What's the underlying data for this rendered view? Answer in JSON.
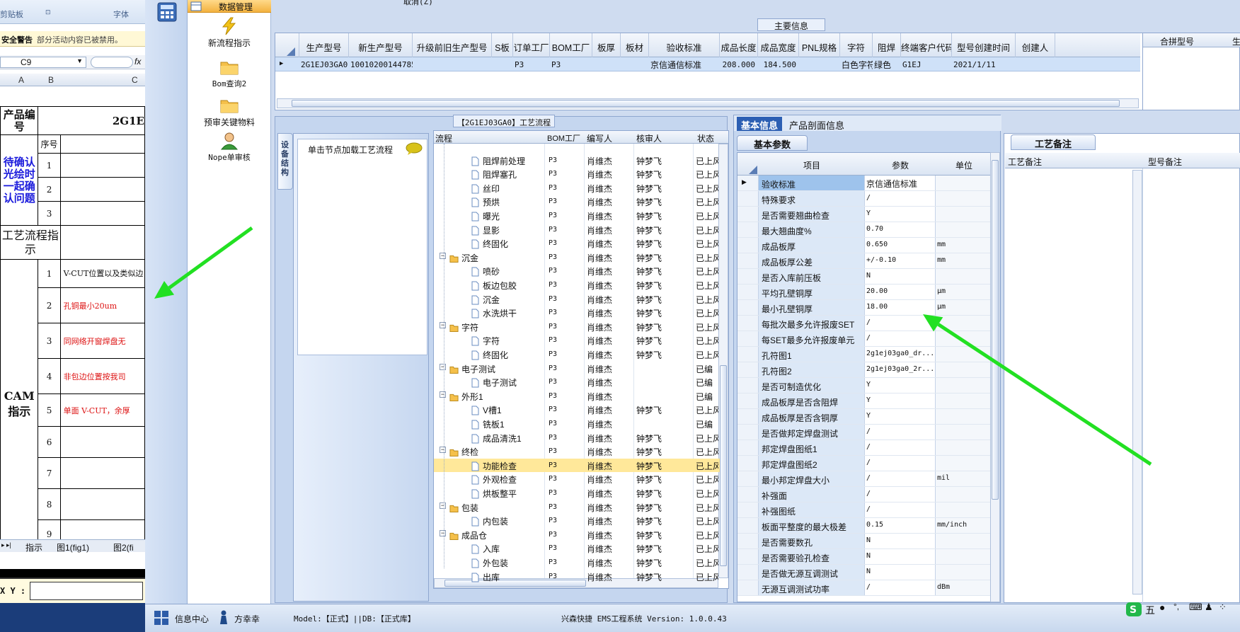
{
  "excel": {
    "ribbon_left": "剪贴板",
    "ribbon_right": "字体",
    "warning_title": "安全警告",
    "warning_text": "部分活动内容已被禁用。",
    "namebox": "C9",
    "fx": "fx",
    "columns": [
      "A",
      "B",
      "C"
    ],
    "product_label": "产品编号",
    "product_value": "2G1E",
    "confirm_label": "待确认光绘时一起确认问题",
    "seq_header": "序号",
    "process_label": "工艺流程指示",
    "cam_label": "CAM指示",
    "rows": [
      {
        "n": "1",
        "text": ""
      },
      {
        "n": "2",
        "text": ""
      },
      {
        "n": "3",
        "text": ""
      }
    ],
    "cam_rows": [
      {
        "n": "1",
        "text": "V-CUT位置以及类似边"
      },
      {
        "n": "2",
        "text": "孔铜最小20um"
      },
      {
        "n": "3",
        "text": "同网络开窗焊盘无"
      },
      {
        "n": "4",
        "text": "非包边位置按我司"
      },
      {
        "n": "5",
        "text": "单面 V-CUT，余厚"
      },
      {
        "n": "6",
        "text": ""
      },
      {
        "n": "7",
        "text": ""
      },
      {
        "n": "8",
        "text": ""
      },
      {
        "n": "9",
        "text": ""
      }
    ],
    "sheet_tabs": [
      "指示",
      "图1(fig1)",
      "图2(fi"
    ],
    "xy_label": "X Y :"
  },
  "nav": {
    "header": "数据管理",
    "items": [
      {
        "label": "新流程指示",
        "icon": "lightning-icon"
      },
      {
        "label": "Bom查询2",
        "icon": "folder-icon"
      },
      {
        "label": "预审关键物料",
        "icon": "folder-icon"
      },
      {
        "label": "Nope单审核",
        "icon": "user-icon"
      }
    ]
  },
  "top": {
    "cancel_label": "取消(Z)",
    "main_info_title": "主要信息",
    "columns": [
      "生产型号",
      "新生产型号",
      "升级前旧生产型号",
      "S板",
      "订单工厂",
      "BOM工厂",
      "板厚",
      "板材",
      "验收标准",
      "成品长度",
      "成品宽度",
      "PNL规格",
      "字符",
      "阻焊",
      "终端客户代码",
      "型号创建时间",
      "创建人"
    ],
    "row": [
      "2G1EJ03GA0",
      "10010200144785",
      "",
      "",
      "P3",
      "P3",
      "",
      "",
      "京信通信标准",
      "208.000",
      "184.500",
      "",
      "白色字符",
      "绿色",
      "G1EJ",
      "2021/1/11",
      ""
    ],
    "merge_header": "合拼型号",
    "merge_header2": "生"
  },
  "process": {
    "title": "【2G1EJ03GA0】工艺流程",
    "structure_tab": "设备结构",
    "load_hint": "单击节点加载工艺流程",
    "headers": [
      "流程",
      "BOM工厂",
      "编写人",
      "核审人",
      "状态"
    ],
    "rows": [
      {
        "level": 2,
        "name": "",
        "factory": "",
        "writer": "",
        "reviewer": "",
        "status": "",
        "group": false
      },
      {
        "level": 2,
        "name": "阻焊前处理",
        "factory": "P3",
        "writer": "肖维杰",
        "reviewer": "钟梦飞",
        "status": "已上风",
        "group": false
      },
      {
        "level": 2,
        "name": "阻焊塞孔",
        "factory": "P3",
        "writer": "肖维杰",
        "reviewer": "钟梦飞",
        "status": "已上风",
        "group": false
      },
      {
        "level": 2,
        "name": "丝印",
        "factory": "P3",
        "writer": "肖维杰",
        "reviewer": "钟梦飞",
        "status": "已上风",
        "group": false
      },
      {
        "level": 2,
        "name": "预烘",
        "factory": "P3",
        "writer": "肖维杰",
        "reviewer": "钟梦飞",
        "status": "已上风",
        "group": false
      },
      {
        "level": 2,
        "name": "曝光",
        "factory": "P3",
        "writer": "肖维杰",
        "reviewer": "钟梦飞",
        "status": "已上风",
        "group": false
      },
      {
        "level": 2,
        "name": "显影",
        "factory": "P3",
        "writer": "肖维杰",
        "reviewer": "钟梦飞",
        "status": "已上风",
        "group": false
      },
      {
        "level": 2,
        "name": "终固化",
        "factory": "P3",
        "writer": "肖维杰",
        "reviewer": "钟梦飞",
        "status": "已上风",
        "group": false
      },
      {
        "level": 1,
        "name": "沉金",
        "factory": "P3",
        "writer": "肖维杰",
        "reviewer": "钟梦飞",
        "status": "已上风",
        "group": true
      },
      {
        "level": 2,
        "name": "喷砂",
        "factory": "P3",
        "writer": "肖维杰",
        "reviewer": "钟梦飞",
        "status": "已上风",
        "group": false
      },
      {
        "level": 2,
        "name": "板边包胶",
        "factory": "P3",
        "writer": "肖维杰",
        "reviewer": "钟梦飞",
        "status": "已上风",
        "group": false
      },
      {
        "level": 2,
        "name": "沉金",
        "factory": "P3",
        "writer": "肖维杰",
        "reviewer": "钟梦飞",
        "status": "已上风",
        "group": false
      },
      {
        "level": 2,
        "name": "水洗烘干",
        "factory": "P3",
        "writer": "肖维杰",
        "reviewer": "钟梦飞",
        "status": "已上风",
        "group": false
      },
      {
        "level": 1,
        "name": "字符",
        "factory": "P3",
        "writer": "肖维杰",
        "reviewer": "钟梦飞",
        "status": "已上风",
        "group": true
      },
      {
        "level": 2,
        "name": "字符",
        "factory": "P3",
        "writer": "肖维杰",
        "reviewer": "钟梦飞",
        "status": "已上风",
        "group": false
      },
      {
        "level": 2,
        "name": "终固化",
        "factory": "P3",
        "writer": "肖维杰",
        "reviewer": "钟梦飞",
        "status": "已上风",
        "group": false
      },
      {
        "level": 1,
        "name": "电子测试",
        "factory": "P3",
        "writer": "肖维杰",
        "reviewer": "",
        "status": "已编",
        "group": true
      },
      {
        "level": 2,
        "name": "电子测试",
        "factory": "P3",
        "writer": "肖维杰",
        "reviewer": "",
        "status": "已编",
        "group": false
      },
      {
        "level": 1,
        "name": "外形1",
        "factory": "P3",
        "writer": "肖维杰",
        "reviewer": "",
        "status": "已编",
        "group": true
      },
      {
        "level": 2,
        "name": "V槽1",
        "factory": "P3",
        "writer": "肖维杰",
        "reviewer": "钟梦飞",
        "status": "已上风",
        "group": false
      },
      {
        "level": 2,
        "name": "铣板1",
        "factory": "P3",
        "writer": "肖维杰",
        "reviewer": "",
        "status": "已编",
        "group": false
      },
      {
        "level": 2,
        "name": "成品清洗1",
        "factory": "P3",
        "writer": "肖维杰",
        "reviewer": "钟梦飞",
        "status": "已上风",
        "group": false
      },
      {
        "level": 1,
        "name": "终检",
        "factory": "P3",
        "writer": "肖维杰",
        "reviewer": "钟梦飞",
        "status": "已上风",
        "group": true
      },
      {
        "level": 2,
        "name": "功能检查",
        "factory": "P3",
        "writer": "肖维杰",
        "reviewer": "钟梦飞",
        "status": "已上风",
        "group": false,
        "selected": true
      },
      {
        "level": 2,
        "name": "外观检查",
        "factory": "P3",
        "writer": "肖维杰",
        "reviewer": "钟梦飞",
        "status": "已上风",
        "group": false
      },
      {
        "level": 2,
        "name": "烘板整平",
        "factory": "P3",
        "writer": "肖维杰",
        "reviewer": "钟梦飞",
        "status": "已上风",
        "group": false
      },
      {
        "level": 1,
        "name": "包装",
        "factory": "P3",
        "writer": "肖维杰",
        "reviewer": "钟梦飞",
        "status": "已上风",
        "group": true
      },
      {
        "level": 2,
        "name": "内包装",
        "factory": "P3",
        "writer": "肖维杰",
        "reviewer": "钟梦飞",
        "status": "已上风",
        "group": false
      },
      {
        "level": 1,
        "name": "成品仓",
        "factory": "P3",
        "writer": "肖维杰",
        "reviewer": "钟梦飞",
        "status": "已上风",
        "group": true
      },
      {
        "level": 2,
        "name": "入库",
        "factory": "P3",
        "writer": "肖维杰",
        "reviewer": "钟梦飞",
        "status": "已上风",
        "group": false
      },
      {
        "level": 2,
        "name": "外包装",
        "factory": "P3",
        "writer": "肖维杰",
        "reviewer": "钟梦飞",
        "status": "已上风",
        "group": false
      },
      {
        "level": 2,
        "name": "出库",
        "factory": "P3",
        "writer": "肖维杰",
        "reviewer": "钟梦飞",
        "status": "已上风",
        "group": false
      }
    ]
  },
  "info": {
    "tabs": [
      "基本信息",
      "产品剖面信息"
    ],
    "subtab": "基本参数",
    "headers": [
      "项目",
      "参数",
      "单位"
    ],
    "rows": [
      {
        "item": "验收标准",
        "value": "京信通信标准",
        "unit": ""
      },
      {
        "item": "特殊要求",
        "value": "/",
        "unit": ""
      },
      {
        "item": "是否需要翘曲检查",
        "value": "Y",
        "unit": ""
      },
      {
        "item": "最大翘曲度%",
        "value": "0.70",
        "unit": ""
      },
      {
        "item": "成品板厚",
        "value": "0.650",
        "unit": "mm"
      },
      {
        "item": "成品板厚公差",
        "value": "+/-0.10",
        "unit": "mm"
      },
      {
        "item": "是否入库前压板",
        "value": "N",
        "unit": ""
      },
      {
        "item": "平均孔壁铜厚",
        "value": "20.00",
        "unit": "μm"
      },
      {
        "item": "最小孔壁铜厚",
        "value": "18.00",
        "unit": "μm"
      },
      {
        "item": "每批次最多允许报废SET",
        "value": "/",
        "unit": ""
      },
      {
        "item": "每SET最多允许报废单元",
        "value": "/",
        "unit": ""
      },
      {
        "item": "孔符图1",
        "value": "2g1ej03ga0_dr...",
        "unit": ""
      },
      {
        "item": "孔符图2",
        "value": "2g1ej03ga0_2r...",
        "unit": ""
      },
      {
        "item": "是否可制造优化",
        "value": "Y",
        "unit": ""
      },
      {
        "item": "成品板厚是否含阻焊",
        "value": "Y",
        "unit": ""
      },
      {
        "item": "成品板厚是否含铜厚",
        "value": "Y",
        "unit": ""
      },
      {
        "item": "是否做邦定焊盘测试",
        "value": "/",
        "unit": ""
      },
      {
        "item": "邦定焊盘图纸1",
        "value": "/",
        "unit": ""
      },
      {
        "item": "邦定焊盘图纸2",
        "value": "/",
        "unit": ""
      },
      {
        "item": "最小邦定焊盘大小",
        "value": "/",
        "unit": "mil"
      },
      {
        "item": "补强面",
        "value": "/",
        "unit": ""
      },
      {
        "item": "补强图纸",
        "value": "/",
        "unit": ""
      },
      {
        "item": "板面平整度的最大极差",
        "value": "0.15",
        "unit": "mm/inch"
      },
      {
        "item": "是否需要数孔",
        "value": "N",
        "unit": ""
      },
      {
        "item": "是否需要验孔检查",
        "value": "N",
        "unit": ""
      },
      {
        "item": "是否做无源互调测试",
        "value": "N",
        "unit": ""
      },
      {
        "item": "无源互调测试功率",
        "value": "/",
        "unit": "dBm"
      }
    ]
  },
  "remarks": {
    "tab": "工艺备注",
    "col1": "工艺备注",
    "col2": "型号备注"
  },
  "status": {
    "info_center": "信息中心",
    "user": "方幸幸",
    "model": "Model:【正式】||DB:【正式库】",
    "system": "兴森快捷 EMS工程系统 Version: 1.0.0.43",
    "ime": "五"
  },
  "colors": {
    "arrow": "#22e022",
    "selected_row": "#ffe89a",
    "active_tab": "#2c5fb3"
  }
}
